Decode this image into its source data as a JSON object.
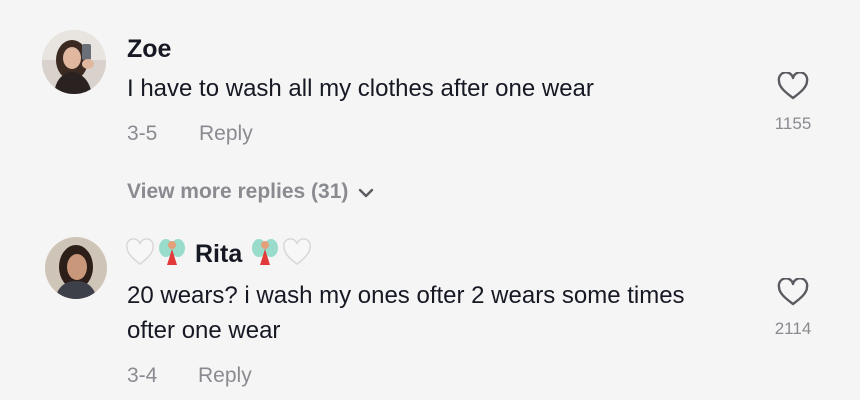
{
  "comments": [
    {
      "username": "Zoe",
      "text": "I have to wash all my clothes after one wear",
      "date": "3-5",
      "reply_label": "Reply",
      "likes": "1155",
      "avatar_icon": "avatar-photo"
    },
    {
      "username": "Rita",
      "name_prefix_emoji": [
        "white-heart-icon",
        "fairy-icon"
      ],
      "name_suffix_emoji": [
        "fairy-icon",
        "white-heart-icon"
      ],
      "text_line1": "20 wears? i wash my ones ofter 2 wears some times",
      "text_line2": "ofter one wear",
      "date": "3-4",
      "reply_label": "Reply",
      "likes": "2114",
      "avatar_icon": "avatar-photo"
    }
  ],
  "view_more_replies": "View more replies (31)",
  "colors": {
    "background": "#f5f5f5",
    "primary_text": "#161823",
    "secondary_text": "#8a8b91"
  }
}
